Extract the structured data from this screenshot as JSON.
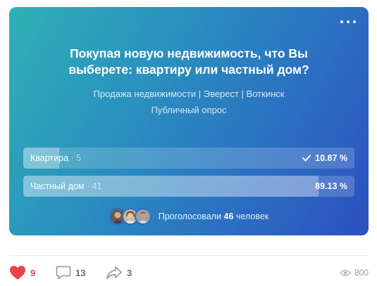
{
  "poll": {
    "title": "Покупая новую недвижимость, что Вы выберете: квартиру или частный дом?",
    "source": "Продажа недвижимости | Эверест | Воткинск",
    "type": "Публичный опрос",
    "options": [
      {
        "label": "Квартира",
        "count": " · 5",
        "percent": "10.87 %",
        "fraction": 0.1087,
        "voted": true
      },
      {
        "label": "Частный дом",
        "count": " · 41",
        "percent": "89.13 %",
        "fraction": 0.8913,
        "voted": false
      }
    ],
    "voters": {
      "prefix": "Проголосовали",
      "count": "46",
      "suffix": "человек"
    }
  },
  "actions": {
    "likes": "9",
    "comments": "13",
    "shares": "3",
    "views": "800"
  },
  "colors": {
    "like": "#e64646",
    "icon": "#99a2ad",
    "card_gradient_start": "#2fb1b6",
    "card_gradient_end": "#2d4fc0"
  },
  "icons": {
    "menu": "more-horizontal-icon",
    "check": "check-icon",
    "like": "heart-icon",
    "comment": "comment-icon",
    "share": "share-icon",
    "views": "eye-icon"
  }
}
